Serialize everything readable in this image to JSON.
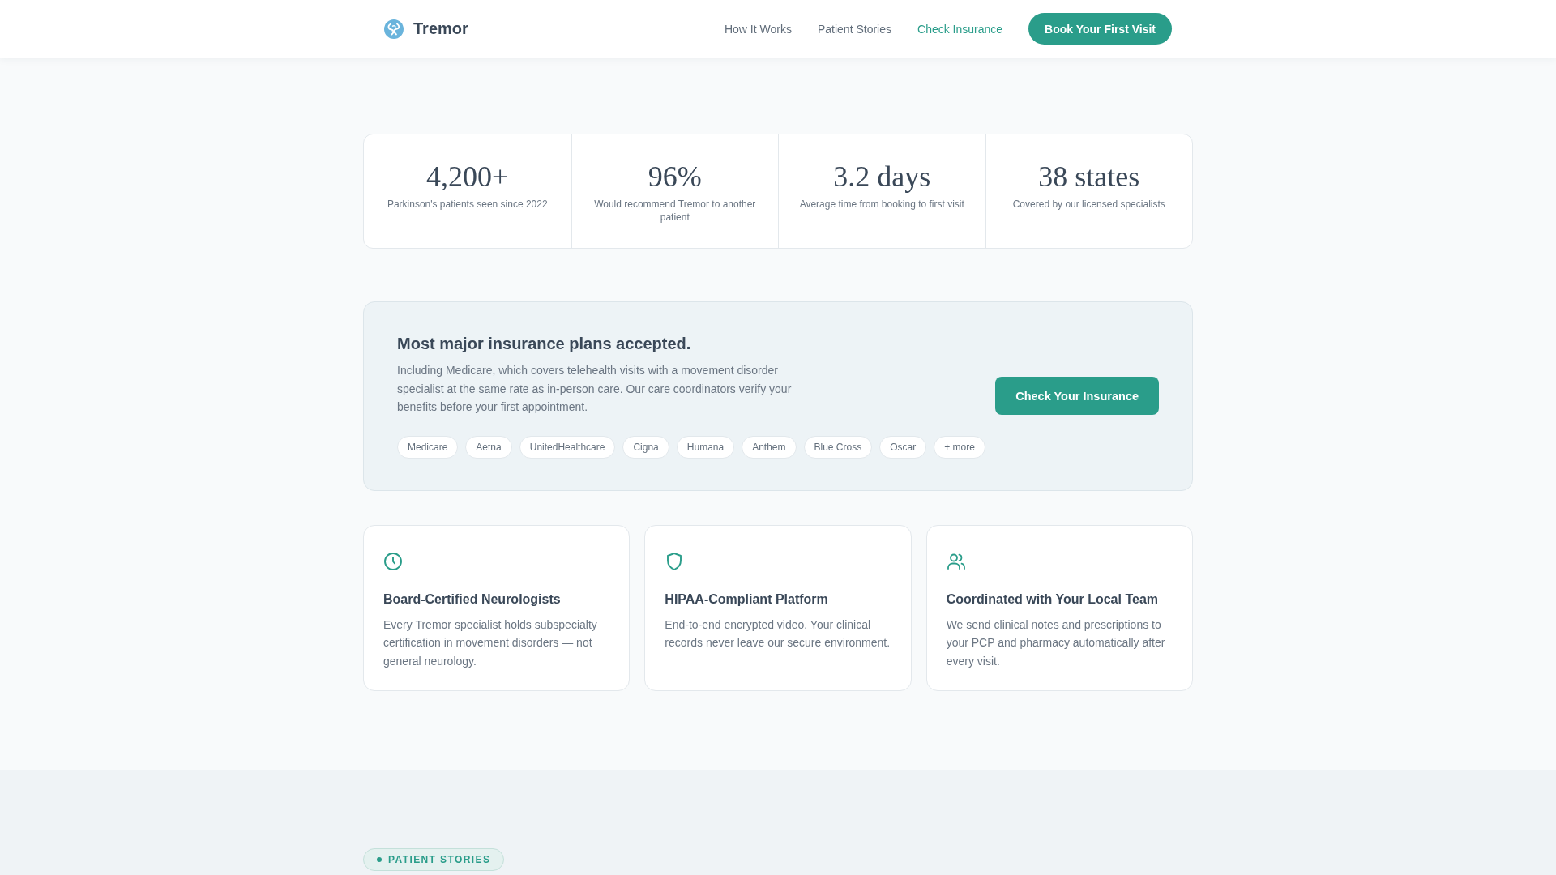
{
  "header": {
    "brand": "Tremor",
    "nav": [
      {
        "label": "How It Works",
        "selected": false
      },
      {
        "label": "Patient Stories",
        "selected": false
      },
      {
        "label": "Check Insurance",
        "selected": true
      }
    ],
    "cta": "Book Your First Visit"
  },
  "stats": [
    {
      "value": "4,200+",
      "label": "Parkinson's patients seen since 2022"
    },
    {
      "value": "96%",
      "label": "Would recommend Tremor to another patient"
    },
    {
      "value": "3.2 days",
      "label": "Average time from booking to first visit"
    },
    {
      "value": "38 states",
      "label": "Covered by our licensed specialists"
    }
  ],
  "insurance": {
    "title": "Most major insurance plans accepted.",
    "text": "Including Medicare, which covers telehealth visits with a movement disorder specialist at the same rate as in-person care. Our care coordinators verify your benefits before your first appointment.",
    "plans": [
      "Medicare",
      "Aetna",
      "UnitedHealthcare",
      "Cigna",
      "Humana",
      "Anthem",
      "Blue Cross",
      "Oscar",
      "+ more"
    ],
    "button": "Check Your Insurance"
  },
  "features": [
    {
      "kind": "clock",
      "title": "Board-Certified Neurologists",
      "text": "Every Tremor specialist holds subspecialty certification in movement disorders — not general neurology."
    },
    {
      "kind": "shield",
      "title": "HIPAA-Compliant Platform",
      "text": "End-to-end encrypted video. Your clinical records never leave our secure environment."
    },
    {
      "kind": "people",
      "title": "Coordinated with Your Local Team",
      "text": "We send clinical notes and prescriptions to your PCP and pharmacy automatically after every visit."
    }
  ],
  "stories": {
    "badge": "PATIENT STORIES"
  }
}
